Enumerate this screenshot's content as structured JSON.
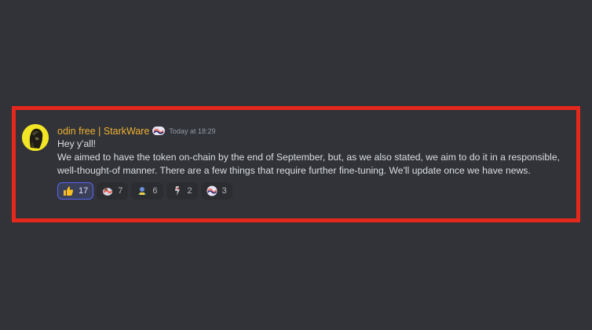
{
  "message": {
    "author": "odin free | StarkWare",
    "author_color": "#f0b132",
    "timestamp": "Today at 18:29",
    "lines": [
      "Hey y'all!",
      "We aimed to have the token on-chain by the end of September, but, as we also stated, we aim to do it in a responsible, well-thought-of manner. There are a few things that require further fine-tuning. We'll update once we have news."
    ],
    "reactions": [
      {
        "emoji": "thumbs-up-emoji",
        "count": "17",
        "active": true
      },
      {
        "emoji": "custom-emoji-1",
        "count": "7",
        "active": false
      },
      {
        "emoji": "custom-emoji-2",
        "count": "6",
        "active": false
      },
      {
        "emoji": "custom-emoji-3",
        "count": "2",
        "active": false
      },
      {
        "emoji": "starkware-emoji",
        "count": "3",
        "active": false
      }
    ]
  },
  "colors": {
    "background": "#313338",
    "highlight_border": "#e5281c",
    "text": "#dbdee1",
    "timestamp": "#949ba4",
    "reaction_active_border": "#5865f2"
  }
}
